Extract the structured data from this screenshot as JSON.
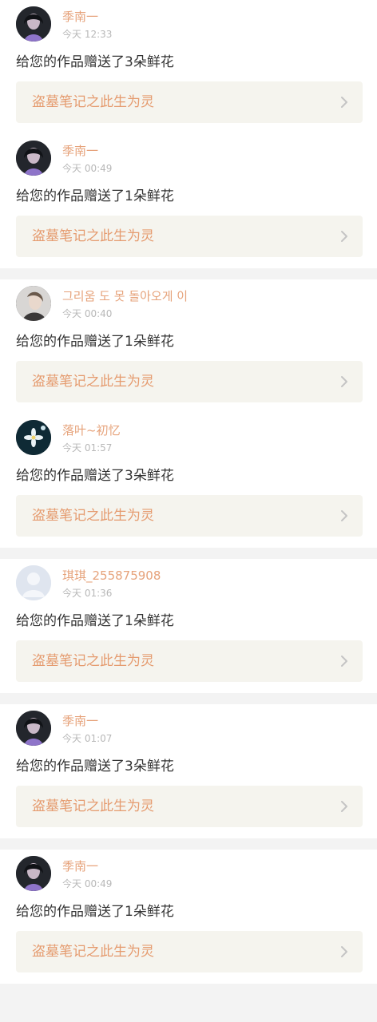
{
  "colors": {
    "username": "#e6a27a",
    "time": "#b8b8b8",
    "message": "#333333",
    "card_bg": "#f5f4ee",
    "card_title": "#e59b6f",
    "divider_bg": "#f3f3f3"
  },
  "groups": [
    {
      "items": [
        {
          "username": "季南一",
          "time": "今天 12:33",
          "message": "给您的作品赠送了3朵鲜花",
          "work_title": "盗墓笔记之此生为灵",
          "avatar": "dark-portrait",
          "chevron_icon": "chevron-right-icon"
        },
        {
          "username": "季南一",
          "time": "今天 00:49",
          "message": "给您的作品赠送了1朵鲜花",
          "work_title": "盗墓笔记之此生为灵",
          "avatar": "dark-portrait",
          "chevron_icon": "chevron-right-icon"
        }
      ]
    },
    {
      "items": [
        {
          "username": "그리움 도 못 돌아오게 이",
          "time": "今天 00:40",
          "message": "给您的作品赠送了1朵鲜花",
          "work_title": "盗墓笔记之此生为灵",
          "avatar": "light-portrait",
          "chevron_icon": "chevron-right-icon"
        },
        {
          "username": "落叶~初忆",
          "time": "今天 01:57",
          "message": "给您的作品赠送了3朵鲜花",
          "work_title": "盗墓笔记之此生为灵",
          "avatar": "flower",
          "chevron_icon": "chevron-right-icon"
        }
      ]
    },
    {
      "items": [
        {
          "username": "琪琪_255875908",
          "time": "今天 01:36",
          "message": "给您的作品赠送了1朵鲜花",
          "work_title": "盗墓笔记之此生为灵",
          "avatar": "default-user",
          "chevron_icon": "chevron-right-icon"
        }
      ]
    },
    {
      "items": [
        {
          "username": "季南一",
          "time": "今天 01:07",
          "message": "给您的作品赠送了3朵鲜花",
          "work_title": "盗墓笔记之此生为灵",
          "avatar": "dark-portrait",
          "chevron_icon": "chevron-right-icon"
        }
      ]
    },
    {
      "items": [
        {
          "username": "季南一",
          "time": "今天 00:49",
          "message": "给您的作品赠送了1朵鲜花",
          "work_title": "盗墓笔记之此生为灵",
          "avatar": "dark-portrait",
          "chevron_icon": "chevron-right-icon"
        }
      ]
    }
  ]
}
